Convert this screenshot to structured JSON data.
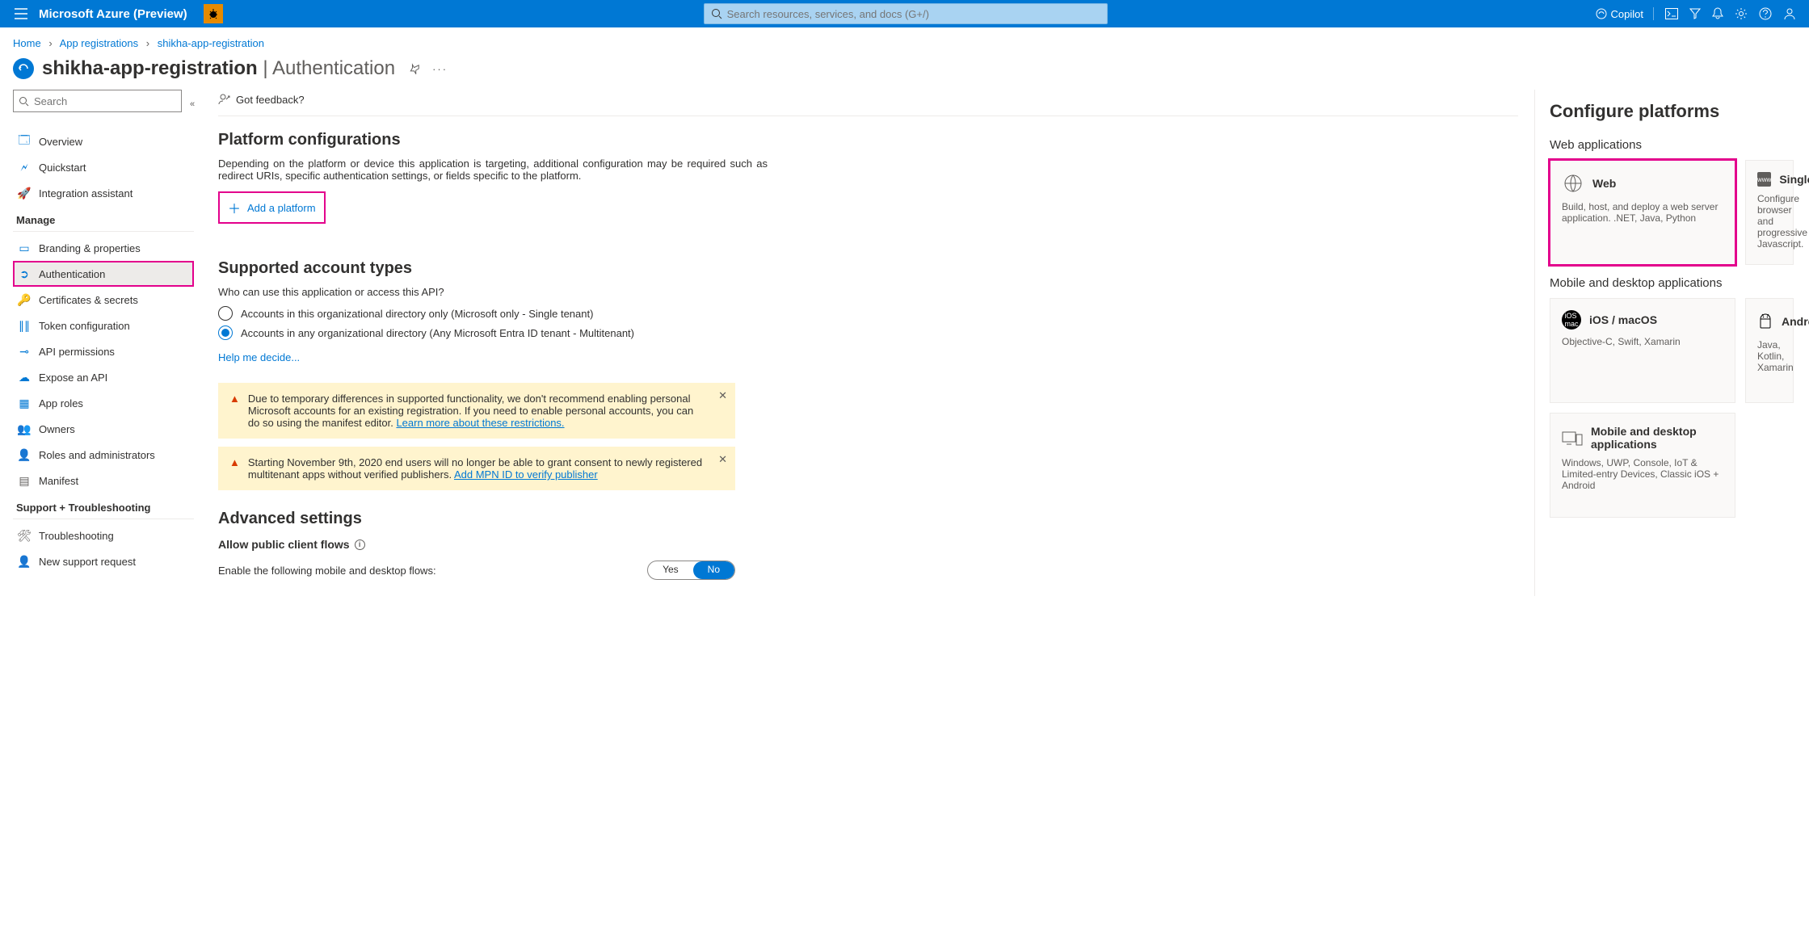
{
  "topbar": {
    "brand": "Microsoft Azure (Preview)",
    "search_placeholder": "Search resources, services, and docs (G+/)",
    "copilot": "Copilot"
  },
  "breadcrumb": {
    "items": [
      "Home",
      "App registrations",
      "shikha-app-registration"
    ]
  },
  "page_title": {
    "app": "shikha-app-registration",
    "section": "Authentication"
  },
  "cmdbar": {
    "feedback": "Got feedback?"
  },
  "sidebar": {
    "search_placeholder": "Search",
    "items_top": [
      {
        "label": "Overview",
        "icon": "🗔",
        "color": "#0078d4"
      },
      {
        "label": "Quickstart",
        "icon": "🗲",
        "color": "#0078d4"
      },
      {
        "label": "Integration assistant",
        "icon": "🚀",
        "color": "#d83b01"
      }
    ],
    "section_manage": "Manage",
    "items_manage": [
      {
        "label": "Branding & properties",
        "icon": "▭",
        "color": "#0078d4"
      },
      {
        "label": "Authentication",
        "icon": "➲",
        "color": "#0078d4",
        "active": true
      },
      {
        "label": "Certificates & secrets",
        "icon": "🔑",
        "color": "#c19c00"
      },
      {
        "label": "Token configuration",
        "icon": "∥∥",
        "color": "#0078d4"
      },
      {
        "label": "API permissions",
        "icon": "⊸",
        "color": "#0078d4"
      },
      {
        "label": "Expose an API",
        "icon": "☁",
        "color": "#0078d4"
      },
      {
        "label": "App roles",
        "icon": "▦",
        "color": "#0078d4"
      },
      {
        "label": "Owners",
        "icon": "👥",
        "color": "#0078d4"
      },
      {
        "label": "Roles and administrators",
        "icon": "👤",
        "color": "#107c10"
      },
      {
        "label": "Manifest",
        "icon": "▤",
        "color": "#605e5c"
      }
    ],
    "section_support": "Support + Troubleshooting",
    "items_support": [
      {
        "label": "Troubleshooting",
        "icon": "🛠",
        "color": "#605e5c"
      },
      {
        "label": "New support request",
        "icon": "👤",
        "color": "#0078d4"
      }
    ]
  },
  "content": {
    "platform_title": "Platform configurations",
    "platform_desc": "Depending on the platform or device this application is targeting, additional configuration may be required such as redirect URIs, specific authentication settings, or fields specific to the platform.",
    "add_platform": "Add a platform",
    "supported_title": "Supported account types",
    "supported_q": "Who can use this application or access this API?",
    "radio1": "Accounts in this organizational directory only (Microsoft only - Single tenant)",
    "radio2": "Accounts in any organizational directory (Any Microsoft Entra ID tenant - Multitenant)",
    "help_decide": "Help me decide...",
    "alert1_text": "Due to temporary differences in supported functionality, we don't recommend enabling personal Microsoft accounts for an existing registration. If you need to enable personal accounts, you can do so using the manifest editor. ",
    "alert1_link": "Learn more about these restrictions.",
    "alert2_text": "Starting November 9th, 2020 end users will no longer be able to grant consent to newly registered multitenant apps without verified publishers. ",
    "alert2_link": "Add MPN ID to verify publisher",
    "advanced_title": "Advanced settings",
    "allow_public": "Allow public client flows",
    "enable_flows": "Enable the following mobile and desktop flows:",
    "toggle_yes": "Yes",
    "toggle_no": "No"
  },
  "panel": {
    "title": "Configure platforms",
    "section_web": "Web applications",
    "section_mobile": "Mobile and desktop applications",
    "cards_web": [
      {
        "title": "Web",
        "desc": "Build, host, and deploy a web server application. .NET, Java, Python"
      },
      {
        "title": "Single",
        "desc": "Configure browser and progressive Javascript."
      }
    ],
    "cards_mobile": [
      {
        "title": "iOS / macOS",
        "desc": "Objective-C, Swift, Xamarin"
      },
      {
        "title": "Android",
        "desc": "Java, Kotlin, Xamarin"
      },
      {
        "title": "Mobile and desktop applications",
        "desc": "Windows, UWP, Console, IoT & Limited-entry Devices, Classic iOS + Android"
      }
    ]
  }
}
